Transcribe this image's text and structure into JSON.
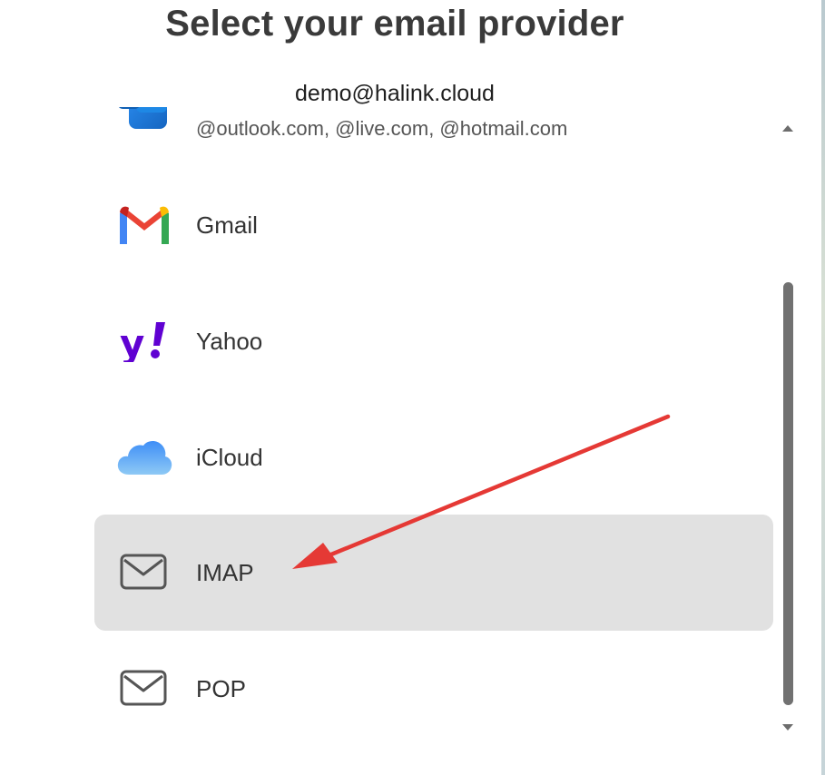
{
  "header": {
    "title": "Select your email provider",
    "account_email": "demo@halink.cloud"
  },
  "providers": [
    {
      "id": "outlook",
      "label": "",
      "subtitle": "@outlook.com, @live.com, @hotmail.com",
      "icon": "outlook-icon"
    },
    {
      "id": "gmail",
      "label": "Gmail",
      "icon": "gmail-icon"
    },
    {
      "id": "yahoo",
      "label": "Yahoo",
      "icon": "yahoo-icon"
    },
    {
      "id": "icloud",
      "label": "iCloud",
      "icon": "icloud-icon"
    },
    {
      "id": "imap",
      "label": "IMAP",
      "icon": "envelope-icon",
      "selected": true
    },
    {
      "id": "pop",
      "label": "POP",
      "icon": "envelope-icon"
    }
  ],
  "colors": {
    "selected_background": "#e1e1e1",
    "annotation_arrow": "#e53935",
    "yahoo_purple": "#6001d2",
    "scrollbar_thumb": "#717171"
  },
  "scrollbar": {
    "has_up_arrow": true,
    "has_down_arrow": true
  }
}
